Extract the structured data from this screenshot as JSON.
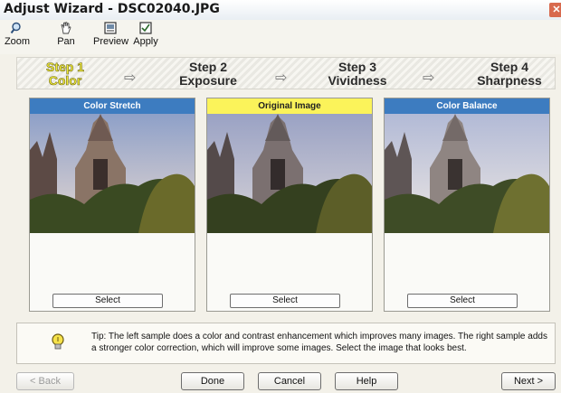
{
  "window": {
    "title": "Adjust Wizard - DSC02040.JPG"
  },
  "toolbar": {
    "tools": [
      {
        "label": "Zoom",
        "icon": "magnifier-icon"
      },
      {
        "label": "Pan",
        "icon": "hand-icon"
      },
      {
        "label": "Preview",
        "icon": "preview-icon"
      },
      {
        "label": "Apply",
        "icon": "apply-icon"
      }
    ]
  },
  "steps": [
    {
      "line1": "Step 1",
      "line2": "Color",
      "active": true
    },
    {
      "line1": "Step 2",
      "line2": "Exposure",
      "active": false
    },
    {
      "line1": "Step 3",
      "line2": "Vividness",
      "active": false
    },
    {
      "line1": "Step 4",
      "line2": "Sharpness",
      "active": false
    }
  ],
  "samples": [
    {
      "title": "Color Stretch",
      "button": "Select"
    },
    {
      "title": "Original Image",
      "button": "Select"
    },
    {
      "title": "Color Balance",
      "button": "Select"
    }
  ],
  "tip": {
    "text": "Tip: The left sample does a color and contrast enhancement which improves many images. The right sample adds a stronger color correction, which will improve some images. Select the image that looks best."
  },
  "buttons": {
    "back": "< Back",
    "done": "Done",
    "cancel": "Cancel",
    "help": "Help",
    "next": "Next >"
  },
  "colors": {
    "header_blue": "#3d7cc0",
    "header_yellow": "#fbf35a",
    "active_step": "#f4ee38"
  }
}
